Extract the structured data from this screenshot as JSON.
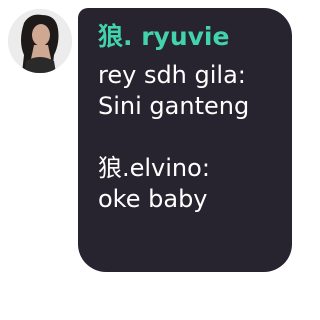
{
  "avatar": {
    "icon": "profile-photo"
  },
  "sender": {
    "name": "狼. ryuvie",
    "color": "#42d3ad"
  },
  "message": {
    "lines": [
      "rey sdh gila:",
      "Sini ganteng",
      "狼.elvino:",
      "oke baby"
    ]
  },
  "colors": {
    "bubble": "#27232f",
    "text": "#ffffff",
    "background": "#ffffff"
  }
}
